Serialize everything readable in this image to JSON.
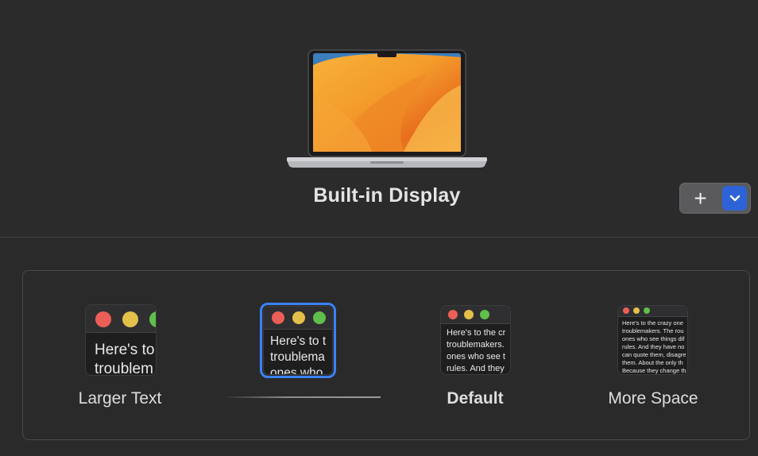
{
  "display": {
    "name": "Built-in Display"
  },
  "controls": {
    "add_label": "+"
  },
  "options": [
    {
      "label": "Larger Text",
      "preview": [
        "Here's to t",
        "troublem"
      ]
    },
    {
      "label": "",
      "preview": [
        "Here's to t",
        "troublema",
        "ones who"
      ],
      "selected": true
    },
    {
      "label": "Default",
      "preview": [
        "Here's to the cr",
        "troublemakers.",
        "ones who see t",
        "rules. And they"
      ]
    },
    {
      "label": "More Space",
      "preview": [
        "Here's to the crazy one",
        "troublemakers. The rou",
        "ones who see things dif",
        "rules. And they have no",
        "can quote them, disagre",
        "them. About the only th",
        "Because they change th"
      ]
    }
  ],
  "colors": {
    "accent": "#3a82f7",
    "dot_red": "#ec5f56",
    "dot_yellow": "#e2c04a",
    "dot_green": "#5fbf4a"
  },
  "icons": {
    "add": "plus-icon",
    "menu": "chevron-down-icon"
  }
}
